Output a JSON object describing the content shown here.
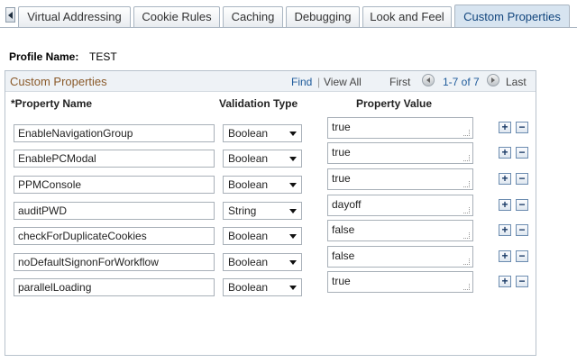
{
  "tabs": [
    {
      "label": "Virtual Addressing",
      "active": false
    },
    {
      "label": "Cookie Rules",
      "active": false
    },
    {
      "label": "Caching",
      "active": false
    },
    {
      "label": "Debugging",
      "active": false
    },
    {
      "label": "Look and Feel",
      "active": false
    },
    {
      "label": "Custom Properties",
      "active": true
    }
  ],
  "profile": {
    "label": "Profile Name:",
    "value": "TEST"
  },
  "grid": {
    "title": "Custom Properties",
    "find": "Find",
    "separator": "|",
    "view_all": "View All",
    "first": "First",
    "range": "1-7 of 7",
    "last": "Last",
    "headers": {
      "name": "*Property Name",
      "type": "Validation Type",
      "value": "Property Value"
    },
    "rows": [
      {
        "name": "EnableNavigationGroup",
        "type": "Boolean",
        "value": "true"
      },
      {
        "name": "EnablePCModal",
        "type": "Boolean",
        "value": "true"
      },
      {
        "name": "PPMConsole",
        "type": "Boolean",
        "value": "true"
      },
      {
        "name": "auditPWD",
        "type": "String",
        "value": "dayoff"
      },
      {
        "name": "checkForDuplicateCookies",
        "type": "Boolean",
        "value": "false"
      },
      {
        "name": "noDefaultSignonForWorkflow",
        "type": "Boolean",
        "value": "false"
      },
      {
        "name": "parallelLoading",
        "type": "Boolean",
        "value": "true"
      }
    ],
    "add_symbol": "+",
    "delete_symbol": "−"
  },
  "colors": {
    "active_tab_bg": "#d7e4f0",
    "active_tab_text": "#12467e",
    "grid_title": "#8a5a2a",
    "link": "#1d5a9a"
  },
  "icons": {
    "tab_scroll": "triangle-left-icon",
    "prev": "circle-arrow-left-icon",
    "next": "circle-arrow-right-icon"
  }
}
